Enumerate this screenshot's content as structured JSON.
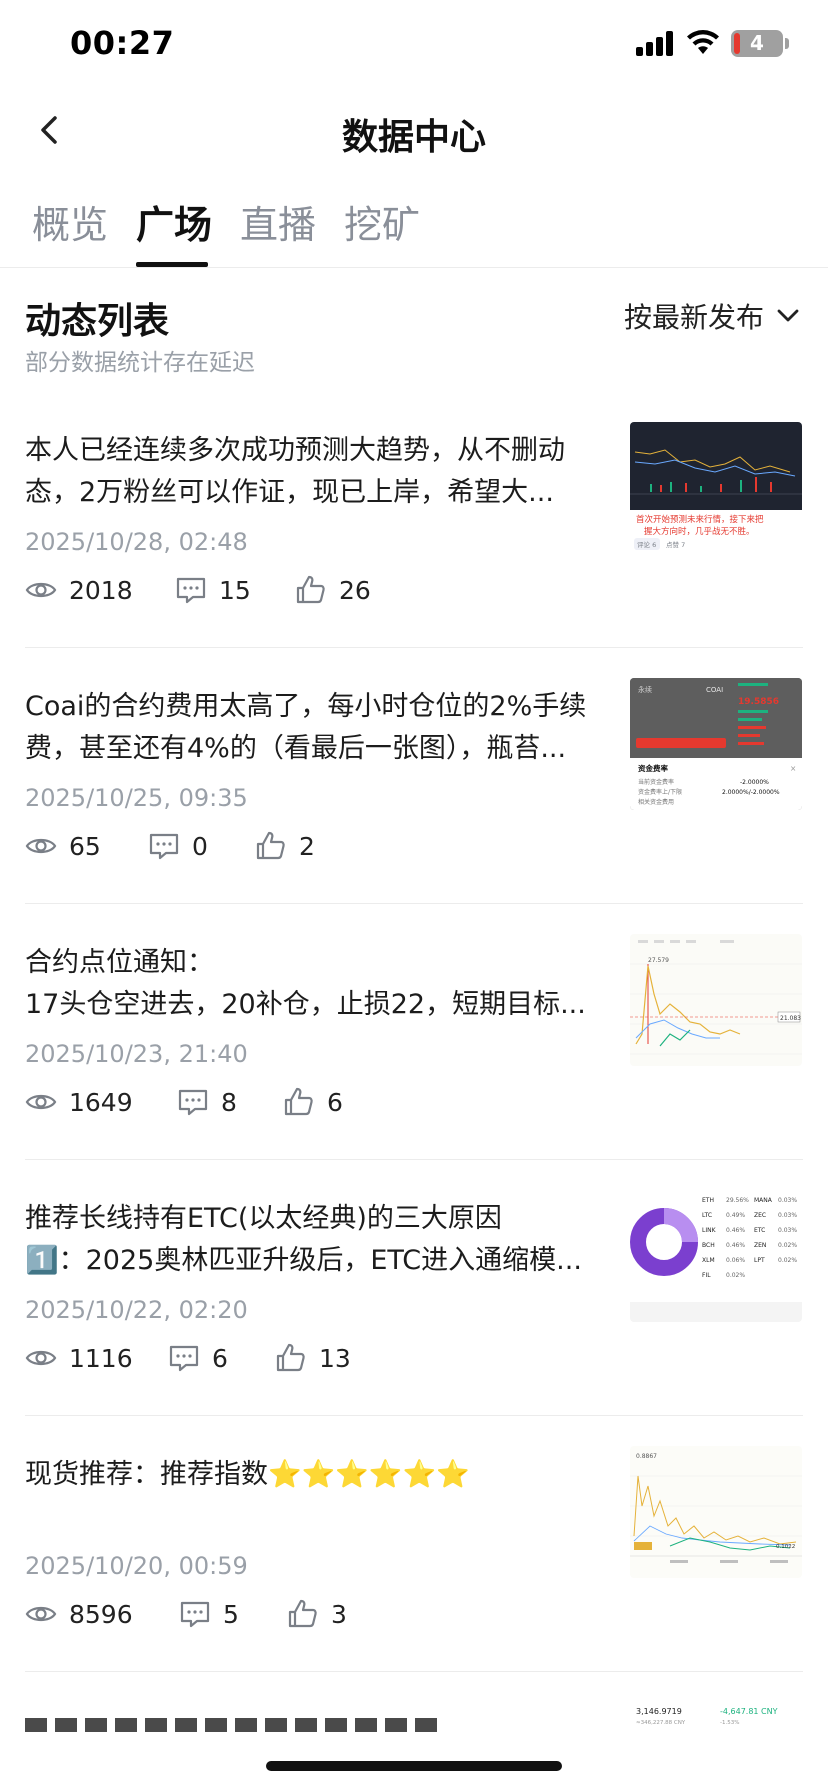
{
  "status_bar": {
    "time": "00:27",
    "battery": "4"
  },
  "header": {
    "title": "数据中心"
  },
  "tabs": [
    {
      "label": "概览",
      "active": false
    },
    {
      "label": "广场",
      "active": true
    },
    {
      "label": "直播",
      "active": false
    },
    {
      "label": "挖矿",
      "active": false
    }
  ],
  "section": {
    "title": "动态列表",
    "subtitle": "部分数据统计存在延迟",
    "sort_label": "按最新发布"
  },
  "posts": [
    {
      "line1": "本人已经连续多次成功预测大趋势，从不删动",
      "line2": "态，2万粉丝可以作证，现已上岸，希望大...",
      "date": "2025/10/28, 02:48",
      "views": "2018",
      "comments": "15",
      "likes": "26",
      "thumb": {
        "caption1": "首次开始预测未来行情，接下来把",
        "caption2": "握大方向时，几乎战无不胜。",
        "tag1": "评论 6",
        "tag2": "点赞 7"
      }
    },
    {
      "line1": "Coai的合约费用太高了，每小时仓位的2%手续",
      "line2": "费，甚至还有4%的（看最后一张图），瓶苔...",
      "date": "2025/10/25, 09:35",
      "views": "65",
      "comments": "0",
      "likes": "2",
      "thumb": {
        "label1": "永续",
        "label2": "COAI",
        "price": "19.5856",
        "panel_title": "资金费率",
        "row1_label": "当前资金费率",
        "row1_value": "-2.0000%",
        "row2_label": "资金费率上/下限",
        "row2_value": "2.0000%/-2.0000%",
        "row3_label": "相关资金费用"
      }
    },
    {
      "line1": "合约点位通知：",
      "line2": "17头仓空进去，20补仓，止损22，短期目标...",
      "date": "2025/10/23, 21:40",
      "views": "1649",
      "comments": "8",
      "likes": "6",
      "thumb": {
        "high": "27.579",
        "last": "21.083"
      }
    },
    {
      "line1": "推荐长线持有ETC(以太经典)的三大原因",
      "line2": "1️⃣：2025奥林匹亚升级后，ETC进入通缩模...",
      "date": "2025/10/22, 02:20",
      "views": "1116",
      "comments": "6",
      "likes": "13",
      "thumb": {
        "coins": [
          "ETH",
          "LTC",
          "LINK",
          "BCH",
          "XLM",
          "FIL"
        ],
        "coins2": [
          "MANA",
          "ZEC",
          "ETC",
          "ZEN",
          "LPT"
        ],
        "pct1": [
          "29.56%",
          "0.49%",
          "0.46%",
          "0.46%",
          "0.06%",
          "0.02%"
        ],
        "pct2": [
          "0.03%",
          "0.03%",
          "0.03%",
          "0.02%",
          "0.02%"
        ]
      }
    },
    {
      "line1": "现货推荐：推荐指数⭐⭐⭐⭐⭐⭐",
      "line2": "",
      "date": "2025/10/20, 00:59",
      "views": "8596",
      "comments": "5",
      "likes": "3",
      "thumb": {
        "high": "0.8867",
        "low": "0.1022"
      }
    }
  ],
  "partial_post": {
    "thumb": {
      "value1": "3,146.9719",
      "value2": "-4,647.81 CNY",
      "sub1": "≈346,227.88 CNY",
      "sub2": "-1.53%"
    }
  },
  "colors": {
    "accent": "#111111",
    "muted": "#9aa0a8",
    "divider": "#ececec",
    "down_red": "#e5392f",
    "up_green": "#1db27f"
  }
}
